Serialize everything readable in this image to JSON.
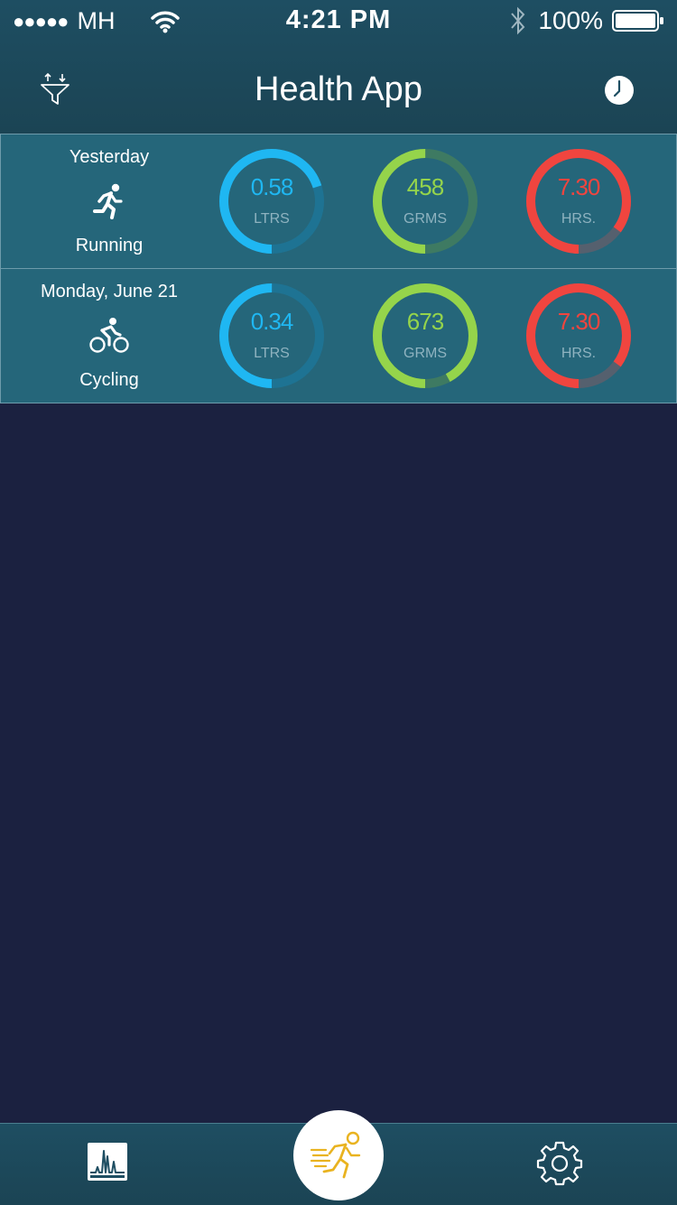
{
  "status_bar": {
    "signal_dots": "●●●●●",
    "carrier": "MH",
    "time": "4:21 PM",
    "battery_percent": "100%"
  },
  "header": {
    "title": "Health App",
    "left_icon": "filter-sort-icon",
    "right_icon": "clock-icon"
  },
  "activities": [
    {
      "date": "Yesterday",
      "name": "Running",
      "icon": "running-icon",
      "rings": [
        {
          "value": "0.58",
          "unit": "LTRS",
          "progress": 0.7,
          "color": "#1fb7f2",
          "track": "#1e7393"
        },
        {
          "value": "458",
          "unit": "GRMS",
          "progress": 0.5,
          "color": "#95d44b",
          "track": "#3e7a62"
        },
        {
          "value": "7.30",
          "unit": "HRS.",
          "progress": 0.85,
          "color": "#f0453f",
          "track": "#55606e"
        }
      ]
    },
    {
      "date": "Monday, June 21",
      "name": "Cycling",
      "icon": "cycling-icon",
      "rings": [
        {
          "value": "0.34",
          "unit": "LTRS",
          "progress": 0.5,
          "color": "#1fb7f2",
          "track": "#1e7393"
        },
        {
          "value": "673",
          "unit": "GRMS",
          "progress": 0.92,
          "color": "#95d44b",
          "track": "#3e7a62"
        },
        {
          "value": "7.30",
          "unit": "HRS.",
          "progress": 0.85,
          "color": "#f0453f",
          "track": "#55606e"
        }
      ]
    }
  ],
  "tabbar": {
    "left_icon": "chart-icon",
    "center_icon": "runner-icon",
    "right_icon": "settings-icon",
    "center_color": "#e9b320"
  },
  "colors": {
    "header": "#1e4e62",
    "row": "#25667a",
    "background": "#1b2140"
  }
}
